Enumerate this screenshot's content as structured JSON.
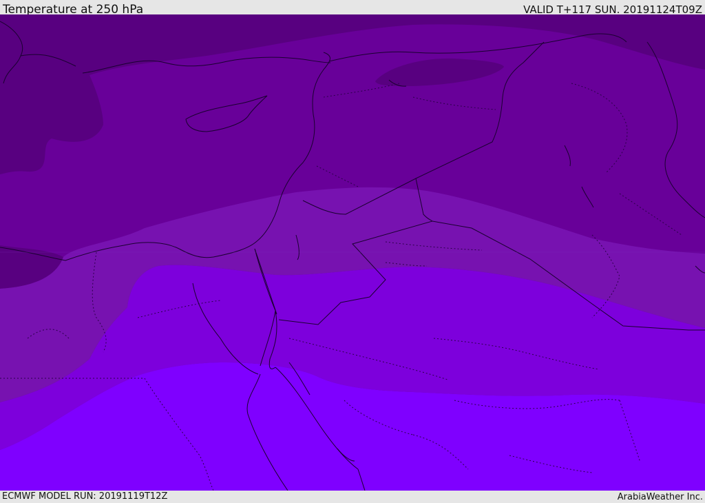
{
  "header": {
    "title": "Temperature at 250 hPa",
    "valid_time": "VALID T+117 SUN. 20191124T09Z"
  },
  "footer": {
    "model_run": "ECMWF MODEL RUN: 20191119T12Z",
    "credit": "ArabiaWeather Inc."
  },
  "map": {
    "palette": {
      "coldest": "#580080",
      "band_1": "#680099",
      "band_2": "#7712b0",
      "band_3": "#7d00dc",
      "warmest": "#7f00ff",
      "coastline": "#1a0030",
      "borders": "#2a0048"
    }
  }
}
